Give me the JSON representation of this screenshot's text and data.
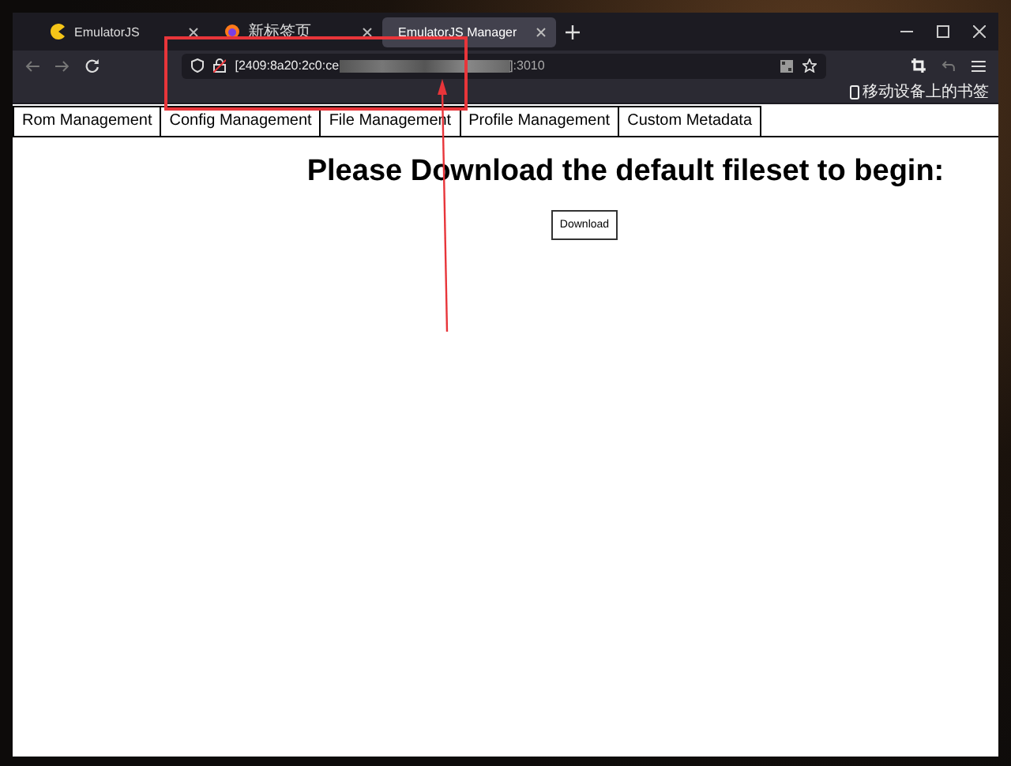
{
  "browser": {
    "tabs": [
      {
        "title": "EmulatorJS",
        "selected": false
      },
      {
        "title": "新标签页",
        "selected": false
      },
      {
        "title": "EmulatorJS Manager",
        "selected": true
      }
    ],
    "address": {
      "prefix": "[2409:8a20:2c0:ce",
      "suffix": "]:3010"
    },
    "bookmarks": "移动设备上的书签"
  },
  "page": {
    "nav": [
      "Rom Management",
      "Config Management",
      "File Management",
      "Profile Management",
      "Custom Metadata"
    ],
    "heading": "Please Download the default fileset to begin:",
    "button": "Download"
  }
}
